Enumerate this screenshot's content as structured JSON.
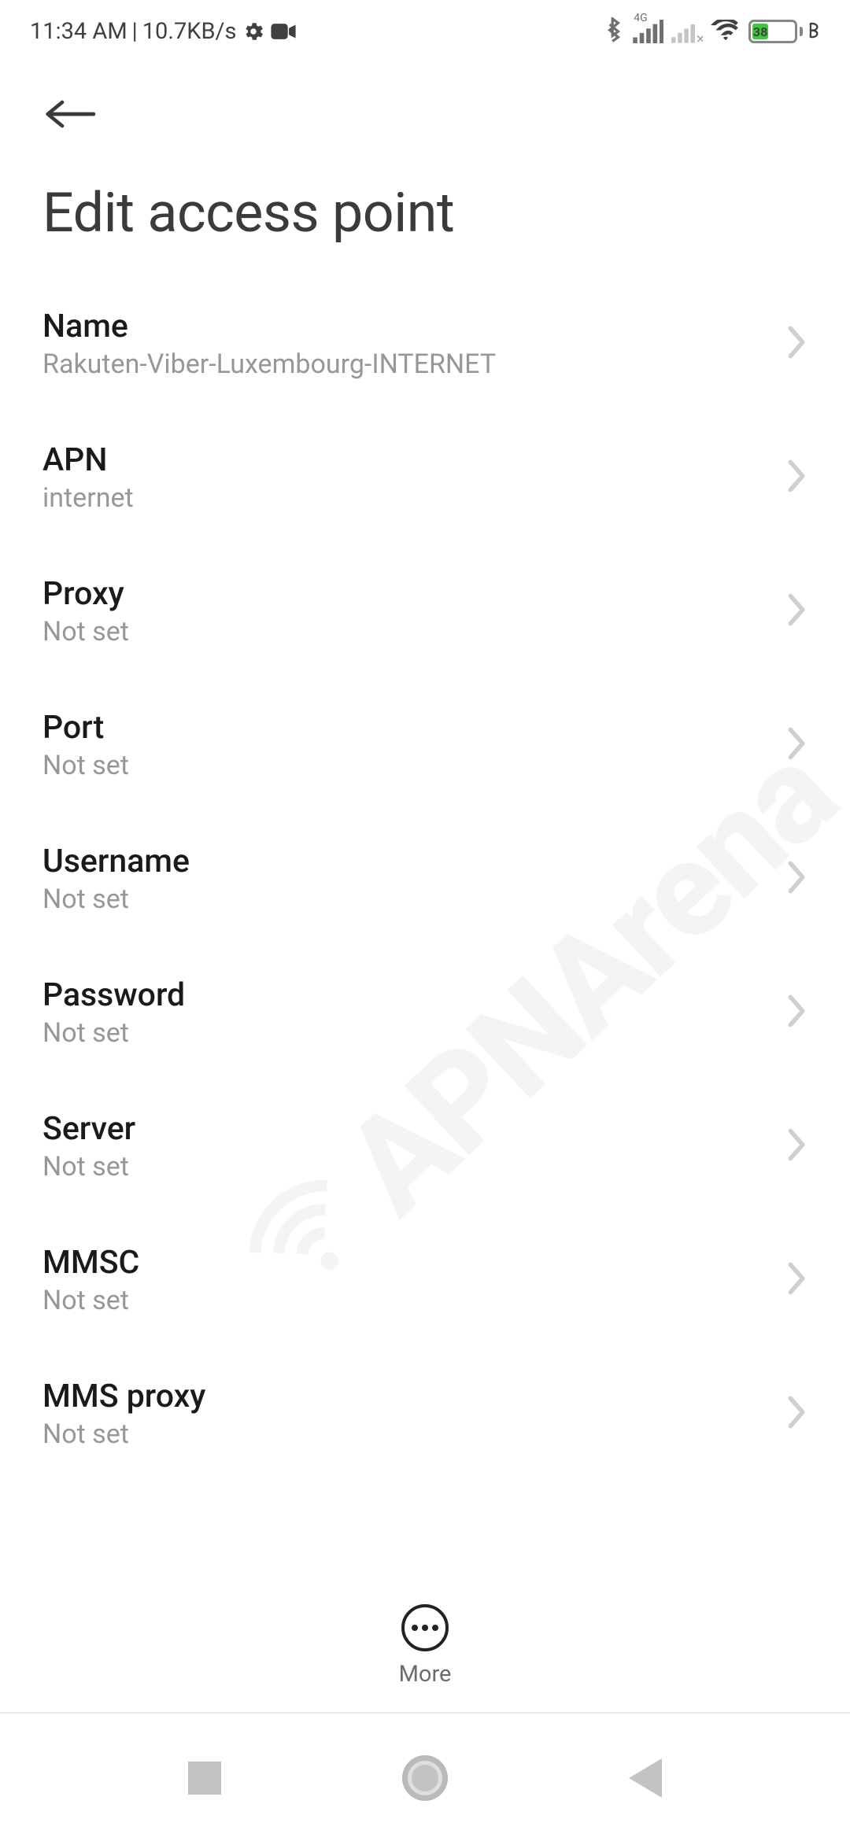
{
  "status_bar": {
    "time": "11:34 AM",
    "separator": "|",
    "speed": "10.7KB/s",
    "network_label": "4G",
    "battery_pct": "38"
  },
  "header": {
    "title": "Edit access point"
  },
  "settings": [
    {
      "label": "Name",
      "value": "Rakuten-Viber-Luxembourg-INTERNET"
    },
    {
      "label": "APN",
      "value": "internet"
    },
    {
      "label": "Proxy",
      "value": "Not set"
    },
    {
      "label": "Port",
      "value": "Not set"
    },
    {
      "label": "Username",
      "value": "Not set"
    },
    {
      "label": "Password",
      "value": "Not set"
    },
    {
      "label": "Server",
      "value": "Not set"
    },
    {
      "label": "MMSC",
      "value": "Not set"
    },
    {
      "label": "MMS proxy",
      "value": "Not set"
    }
  ],
  "bottom": {
    "more_label": "More"
  },
  "watermark": "APNArena"
}
